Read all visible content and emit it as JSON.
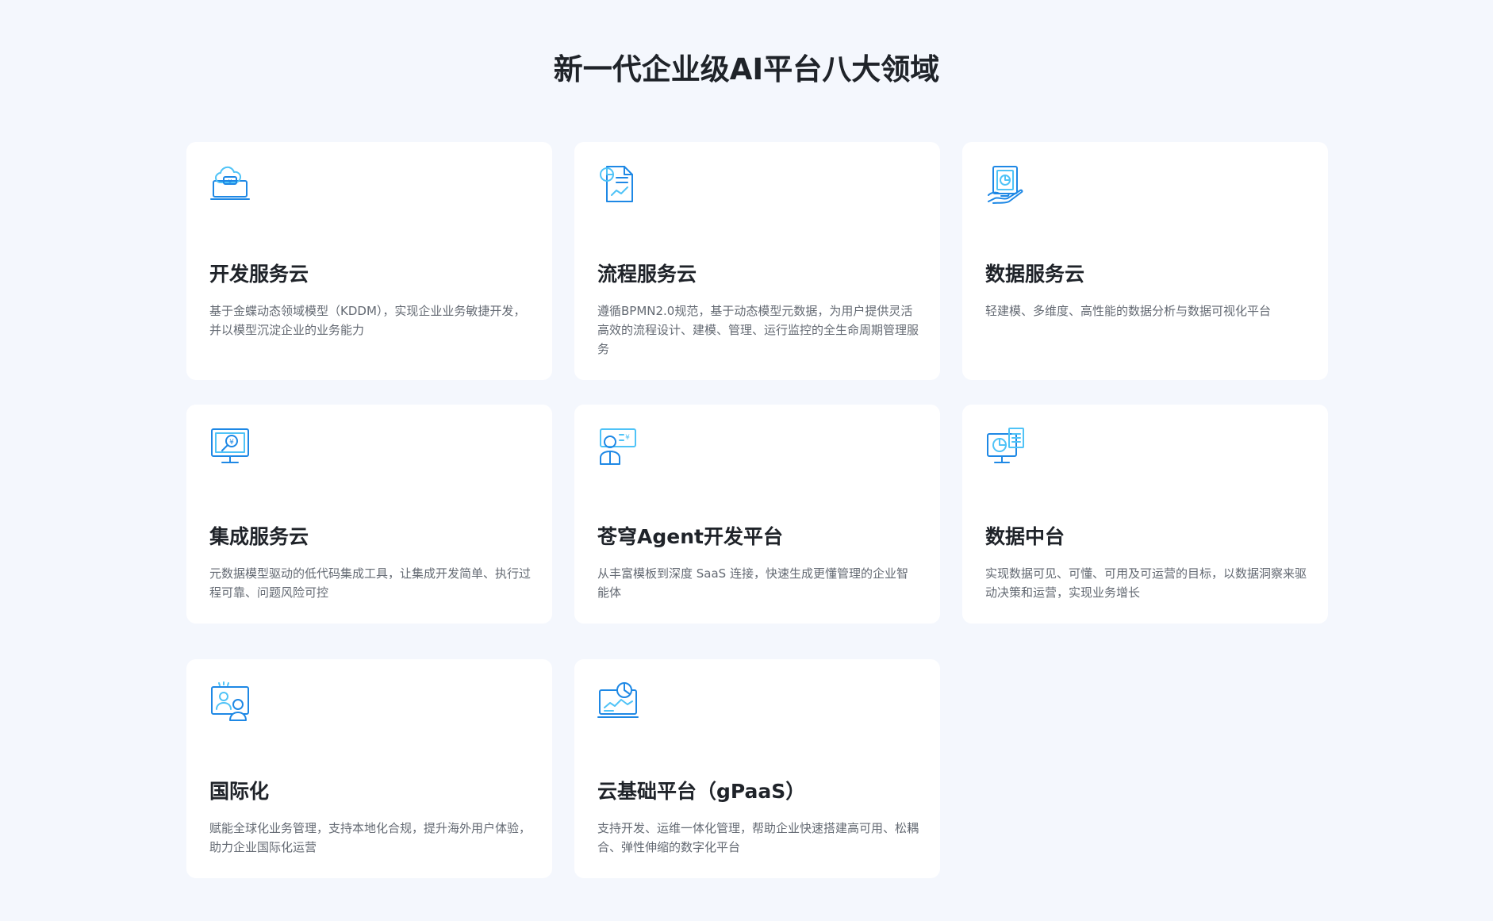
{
  "header": {
    "title": "新一代企业级AI平台八大领域"
  },
  "colors": {
    "background": "#f4f7fd",
    "card": "#ffffff",
    "icon_primary": "#1e88e5",
    "icon_accent": "#4fc3f7",
    "title": "#1f2329",
    "desc": "#646a73"
  },
  "cards": [
    {
      "title": "开发服务云",
      "desc": "基于金蝶动态领域模型（KDDM），实现企业业务敏捷开发，并以模型沉淀企业的业务能力",
      "icon": "cloud-laptop-icon"
    },
    {
      "title": "流程服务云",
      "desc": "遵循BPMN2.0规范，基于动态模型元数据，为用户提供灵活高效的流程设计、建模、管理、运行监控的全生命周期管理服务",
      "icon": "process-document-icon"
    },
    {
      "title": "数据服务云",
      "desc": "轻建模、多维度、高性能的数据分析与数据可视化平台",
      "icon": "data-hand-icon"
    },
    {
      "title": "集成服务云",
      "desc": "元数据模型驱动的低代码集成工具，让集成开发简单、执行过程可靠、问题风险可控",
      "icon": "monitor-search-icon"
    },
    {
      "title": "苍穹Agent开发平台",
      "desc": "从丰富模板到深度 SaaS 连接，快速生成更懂管理的企业智能体",
      "icon": "agent-person-icon"
    },
    {
      "title": "数据中台",
      "desc": "实现数据可见、可懂、可用及可运营的目标，以数据洞察来驱动决策和运营，实现业务增长",
      "icon": "data-monitor-icon"
    },
    {
      "title": "国际化",
      "desc": "赋能全球化业务管理，支持本地化合规，提升海外用户体验，助力企业国际化运营",
      "icon": "global-users-icon"
    },
    {
      "title": "云基础平台（gPaaS）",
      "desc": "支持开发、运维一体化管理，帮助企业快速搭建高可用、松耦合、弹性伸缩的数字化平台",
      "icon": "cloud-platform-icon"
    }
  ]
}
